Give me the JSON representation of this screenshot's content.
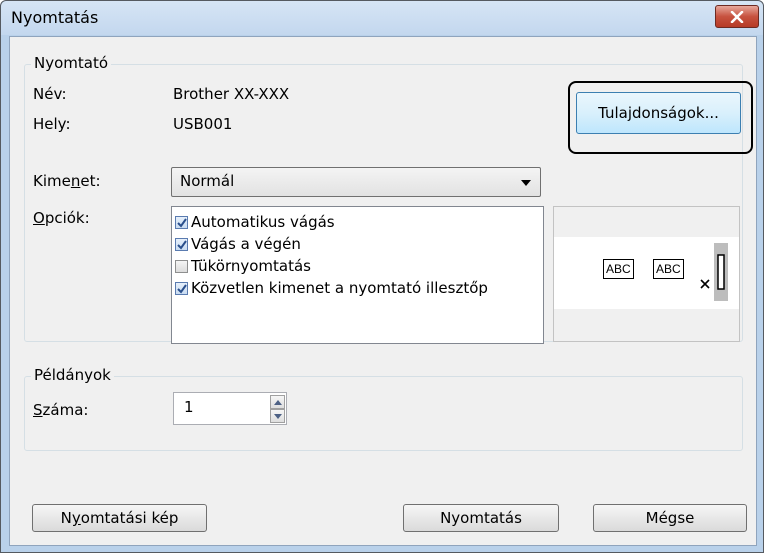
{
  "window": {
    "title": "Nyomtatás"
  },
  "printer_group": {
    "legend": "Nyomtató",
    "name_label": "Név:",
    "name_value": "Brother XX-XXX",
    "location_label": "Hely:",
    "location_value": "USB001",
    "properties_button": "Tulajdonságok..."
  },
  "output": {
    "label_pre": "Kime",
    "label_accel": "n",
    "label_post": "et:",
    "selected": "Normál"
  },
  "options": {
    "label_accel": "O",
    "label_post": "pciók:",
    "items": [
      {
        "label": "Automatikus vágás",
        "checked": true
      },
      {
        "label": "Vágás a végén",
        "checked": true
      },
      {
        "label": "Tükörnyomtatás",
        "checked": false
      },
      {
        "label": "Közvetlen kimenet a nyomtató illesztőp",
        "checked": true
      }
    ],
    "preview_labels": [
      "ABC",
      "ABC"
    ]
  },
  "copies_group": {
    "legend": "Példányok",
    "label_accel": "S",
    "label_post": "záma:",
    "value": "1"
  },
  "buttons": {
    "preview_pre": "N",
    "preview_accel": "y",
    "preview_post": "omtatási kép",
    "print": "Nyomtatás",
    "cancel": "Mégse"
  },
  "colors": {
    "title_bar": "#c3d7ee",
    "close_button": "#c7523f",
    "dialog_bg": "#f0f0f0",
    "check_mark": "#2a4f8c"
  }
}
